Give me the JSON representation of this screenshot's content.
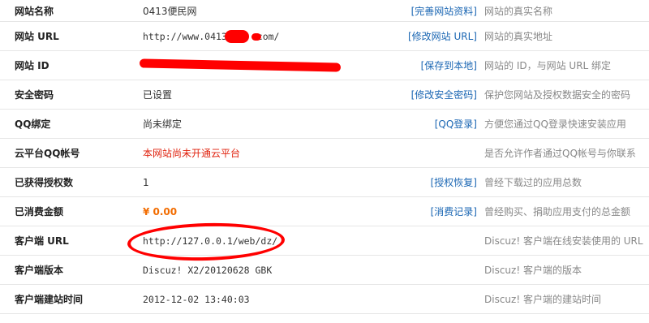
{
  "rows": [
    {
      "label": "网站名称",
      "value": "0413便民网",
      "action": "[完善网站资料]",
      "desc": "网站的真实名称"
    },
    {
      "label": "网站 URL",
      "value": "http://www.0413",
      "value_suffix": ".com/",
      "action": "[修改网站 URL]",
      "desc": "网站的真实地址"
    },
    {
      "label": "网站 ID",
      "value": "",
      "action": "[保存到本地]",
      "desc": "网站的 ID，与网站 URL 绑定"
    },
    {
      "label": "安全密码",
      "value": "已设置",
      "action": "[修改安全密码]",
      "desc": "保护您网站及授权数据安全的密码"
    },
    {
      "label": "QQ绑定",
      "value": "尚未绑定",
      "action": "[QQ登录]",
      "desc": "方便您通过QQ登录快速安装应用"
    },
    {
      "label": "云平台QQ帐号",
      "value": "本网站尚未开通云平台",
      "action": "",
      "desc": "是否允许作者通过QQ帐号与你联系"
    },
    {
      "label": "已获得授权数",
      "value": "1",
      "action": "[授权恢复]",
      "desc": "曾经下载过的应用总数"
    },
    {
      "label": "已消费金额",
      "value": "¥ 0.00",
      "action": "[消费记录]",
      "desc": "曾经购买、捐助应用支付的总金额"
    },
    {
      "label": "客户端 URL",
      "value": "http://127.0.0.1/web/dz/",
      "action": "",
      "desc": "Discuz! 客户端在线安装使用的 URL"
    },
    {
      "label": "客户端版本",
      "value": "Discuz! X2/20120628 GBK",
      "action": "",
      "desc": "Discuz! 客户端的版本"
    },
    {
      "label": "客户端建站时间",
      "value": "2012-12-02 13:40:03",
      "action": "",
      "desc": "Discuz! 客户端的建站时间"
    }
  ],
  "colors": {
    "link": "#1a66b3",
    "warning": "#e0220e",
    "money": "#f26c00",
    "annotation": "#ff0000"
  }
}
